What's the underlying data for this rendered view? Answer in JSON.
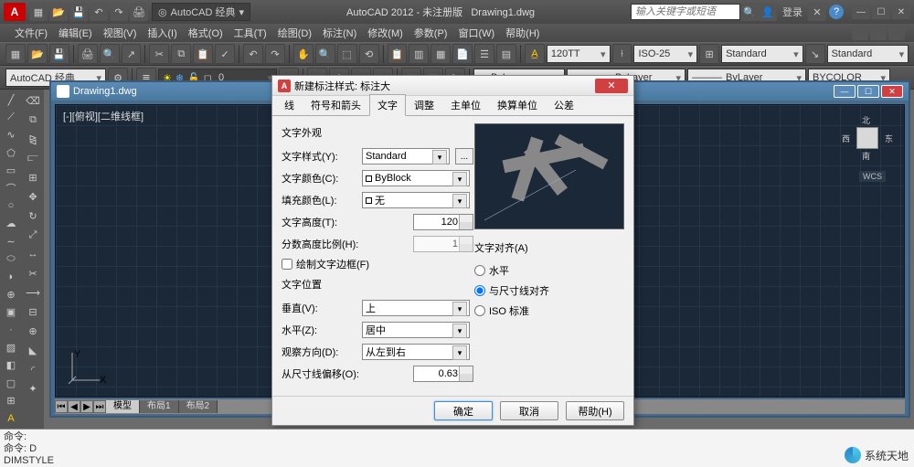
{
  "app": {
    "title_left": "AutoCAD 2012 - 未注册版",
    "doc_name": "Drawing1.dwg",
    "workspace": "AutoCAD 经典",
    "search_placeholder": "输入关键字或短语",
    "login": "登录"
  },
  "menu": [
    "文件(F)",
    "编辑(E)",
    "视图(V)",
    "插入(I)",
    "格式(O)",
    "工具(T)",
    "绘图(D)",
    "标注(N)",
    "修改(M)",
    "参数(P)",
    "窗口(W)",
    "帮助(H)"
  ],
  "toolbar2": {
    "workspace": "AutoCAD 经典",
    "annoscale": "120TT",
    "dimstyle": "ISO-25",
    "textstyle1": "Standard",
    "textstyle2": "Standard"
  },
  "layerbar": {
    "layer_combo": "ByLayer",
    "lt_combo": "ByLayer",
    "lw_combo": "ByLayer",
    "color_combo": "BYCOLOR"
  },
  "drawing": {
    "title": "Drawing1.dwg",
    "view_label": "[-][俯视][二维线框]",
    "wcs": "WCS",
    "cube": {
      "n": "北",
      "s": "南",
      "e": "东",
      "w": "西"
    },
    "axis_x": "X",
    "axis_y": "Y",
    "tabs": [
      "模型",
      "布局1",
      "布局2"
    ]
  },
  "dialog": {
    "title": "新建标注样式: 标注大",
    "tabs": [
      "线",
      "符号和箭头",
      "文字",
      "调整",
      "主单位",
      "换算单位",
      "公差"
    ],
    "active_tab": 2,
    "group_appearance": "文字外观",
    "text_style_label": "文字样式(Y):",
    "text_style_value": "Standard",
    "text_color_label": "文字颜色(C):",
    "text_color_value": "ByBlock",
    "fill_color_label": "填充颜色(L):",
    "fill_color_value": "无",
    "text_height_label": "文字高度(T):",
    "text_height_value": "120",
    "fraction_label": "分数高度比例(H):",
    "fraction_value": "1",
    "frame_checkbox": "绘制文字边框(F)",
    "group_position": "文字位置",
    "vertical_label": "垂直(V):",
    "vertical_value": "上",
    "horizontal_label": "水平(Z):",
    "horizontal_value": "居中",
    "viewdir_label": "观察方向(D):",
    "viewdir_value": "从左到右",
    "offset_label": "从尺寸线偏移(O):",
    "offset_value": "0.63",
    "group_align": "文字对齐(A)",
    "radio_horizontal": "水平",
    "radio_aligned": "与尺寸线对齐",
    "radio_iso": "ISO 标准",
    "btn_ok": "确定",
    "btn_cancel": "取消",
    "btn_help": "帮助(H)"
  },
  "cmd": {
    "l1": "命令:",
    "l2": "命令: D",
    "l3": "DIMSTYLE"
  },
  "watermark": "系统天地"
}
